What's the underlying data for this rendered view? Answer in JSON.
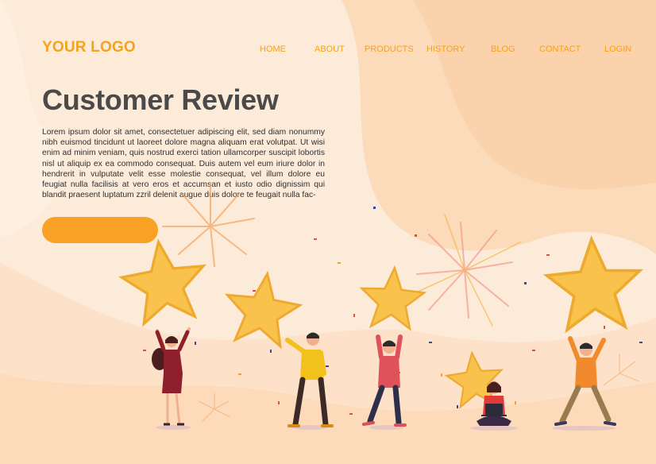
{
  "brand": {
    "logo_text": "YOUR LOGO"
  },
  "nav": {
    "items": [
      {
        "label": "HOME"
      },
      {
        "label": "ABOUT"
      },
      {
        "label": "PRODUCTS"
      },
      {
        "label": "HISTORY"
      },
      {
        "label": "BLOG"
      },
      {
        "label": "CONTACT"
      },
      {
        "label": "LOGIN"
      }
    ]
  },
  "hero": {
    "title": "Customer Review",
    "body": "Lorem ipsum dolor sit amet, consectetuer adipiscing elit, sed diam nonummy nibh euismod tincidunt ut laoreet dolore magna aliquam erat volutpat. Ut wisi enim ad minim veniam, quis nostrud exerci tation ullamcorper suscipit lobortis nisl ut aliquip ex ea commodo consequat. Duis autem vel eum iriure dolor in hendrerit in vulputate velit esse molestie consequat, vel illum dolore eu feugiat nulla facilisis at vero eros et accumsan et iusto odio dignissim qui blandit praesent luptatum zzril delenit augue duis dolore te feugait nulla fac-",
    "cta_label": ""
  },
  "colors": {
    "accent": "#f5a21c",
    "button": "#f9a125",
    "star": "#f8c24c",
    "background": "#fdebd9",
    "title": "#4a4a4a"
  }
}
